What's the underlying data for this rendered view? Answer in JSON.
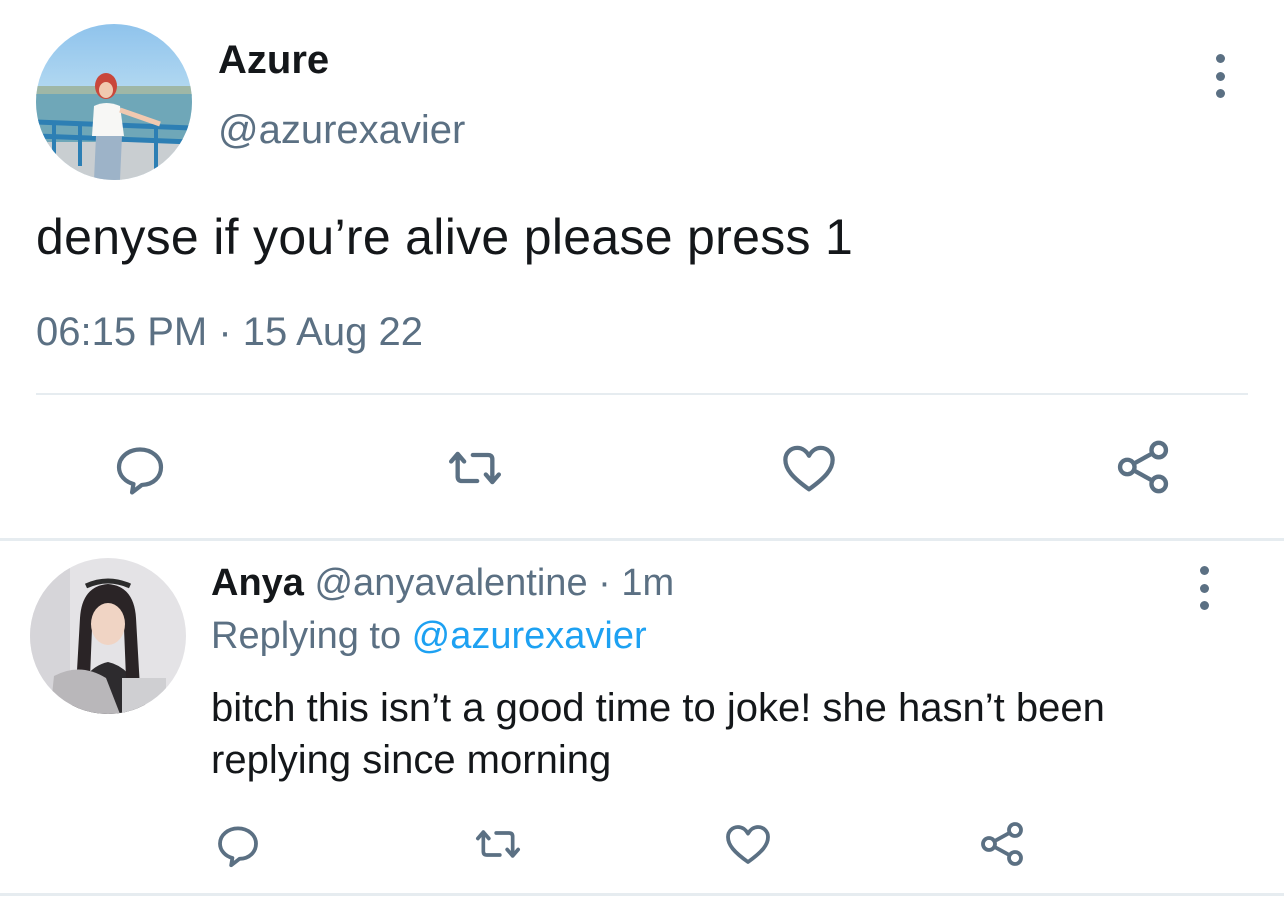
{
  "tweet": {
    "author_name": "Azure",
    "author_handle": "@azurexavier",
    "text": "denyse if you’re alive please press 1",
    "timestamp": "06:15 PM · 15 Aug 22",
    "avatar_icon": "avatar-photo-azure",
    "actions": [
      "reply-icon",
      "retweet-icon",
      "like-icon",
      "share-icon"
    ],
    "more_icon": "more-vertical-icon"
  },
  "reply": {
    "author_name": "Anya",
    "author_handle": "@anyavalentine",
    "separator": " · ",
    "time_ago": "1m",
    "replying_prefix": "Replying to ",
    "replying_to": "@azurexavier",
    "text": "bitch this isn’t a good time to joke! she hasn’t been replying since morning",
    "avatar_icon": "avatar-photo-anya",
    "actions": [
      "reply-icon",
      "retweet-icon",
      "like-icon",
      "share-icon"
    ],
    "more_icon": "more-vertical-icon"
  },
  "colors": {
    "text_primary": "#14171a",
    "text_secondary": "#5b7083",
    "link": "#1da1f2",
    "divider": "#e6ecf0",
    "icon": "#5b7083"
  }
}
